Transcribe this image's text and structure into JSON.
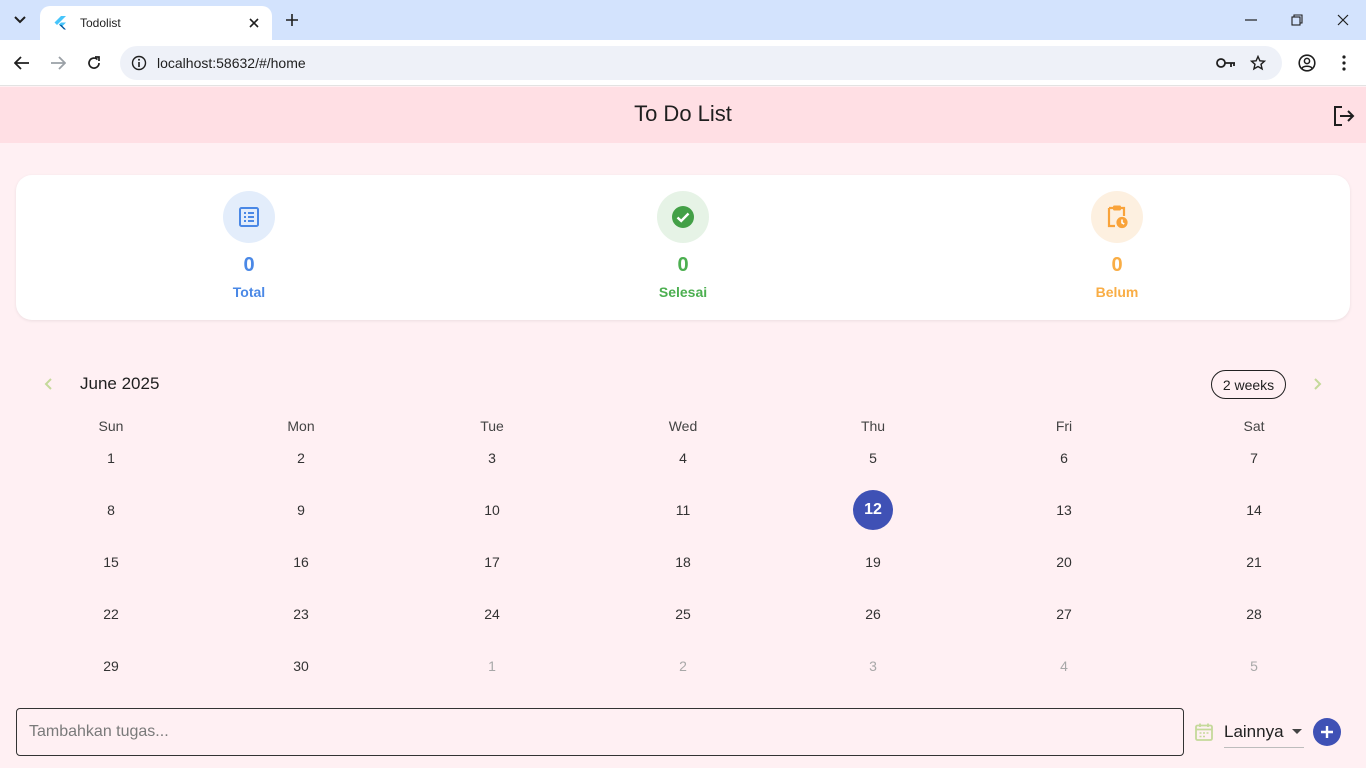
{
  "browser": {
    "tab_title": "Todolist",
    "url": "localhost:58632/#/home"
  },
  "app": {
    "title": "To Do List"
  },
  "stats": [
    {
      "value": "0",
      "label": "Total",
      "color": "#4a88e6",
      "bg": "#e3edfb",
      "icon": "list-icon"
    },
    {
      "value": "0",
      "label": "Selesai",
      "color": "#4caf50",
      "bg": "#e6f3e6",
      "icon": "check-circle-icon"
    },
    {
      "value": "0",
      "label": "Belum",
      "color": "#f9ad45",
      "bg": "#fdf0e0",
      "icon": "pending-clipboard-icon"
    }
  ],
  "calendar": {
    "month_label": "June 2025",
    "format_button": "2 weeks",
    "weekdays": [
      "Sun",
      "Mon",
      "Tue",
      "Wed",
      "Thu",
      "Fri",
      "Sat"
    ],
    "selected_day": "12",
    "weeks": [
      [
        "1",
        "2",
        "3",
        "4",
        "5",
        "6",
        "7"
      ],
      [
        "8",
        "9",
        "10",
        "11",
        "12",
        "13",
        "14"
      ],
      [
        "15",
        "16",
        "17",
        "18",
        "19",
        "20",
        "21"
      ],
      [
        "22",
        "23",
        "24",
        "25",
        "26",
        "27",
        "28"
      ],
      [
        "29",
        "30",
        "1",
        "2",
        "3",
        "4",
        "5"
      ]
    ],
    "outside_days_last_row": [
      false,
      false,
      true,
      true,
      true,
      true,
      true
    ],
    "accent_color": "#3f51b5",
    "chevron_color": "#c5d99a"
  },
  "input": {
    "placeholder": "Tambahkan tugas...",
    "value": ""
  },
  "category": {
    "selected": "Lainnya"
  }
}
